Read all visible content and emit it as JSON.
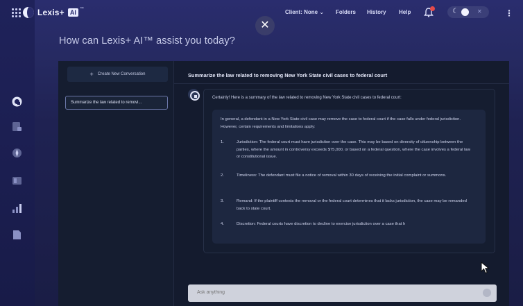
{
  "app": {
    "logo_text": "Lexis+",
    "logo_ai": "AI",
    "logo_tm": "™",
    "heading": "How can Lexis+ AI™ assist you today?"
  },
  "nav": {
    "client": "Client: None ⌄",
    "folders": "Folders",
    "history": "History",
    "help": "Help",
    "close_symbol": "✕",
    "moon_symbol": "☾",
    "toggle_off_symbol": "✕",
    "kebab_symbol": "⋮"
  },
  "sidebar": {
    "new_conversation": "Create New Conversation",
    "plus_symbol": "+",
    "conversations": [
      {
        "label": "Summarize the law related to removi..."
      }
    ]
  },
  "conversation": {
    "title": "Summarize the law related to removing New York State civil cases to federal court",
    "intro": "Certainly! Here is a summary of the law related to removing New York State civil cases to federal court:",
    "paragraph": "In general, a defendant in a New York State civil case may remove the case to federal court if the case falls under federal jurisdiction. However, certain requirements and limitations apply:",
    "items": [
      {
        "num": "1.",
        "text": "Jurisdiction: The federal court must have jurisdiction over the case. This may be based on diversity of citizenship between the parties, where the amount in controversy exceeds $75,000, or based on a federal question, where the case involves a federal law or constitutional issue."
      },
      {
        "num": "2.",
        "text": "Timeliness: The defendant must file a notice of removal within 30 days of receiving the initial complaint or summons."
      },
      {
        "num": "3.",
        "text": "Remand: If the plaintiff contests the removal or the federal court determines that it lacks jurisdiction, the case may be remanded back to state court."
      },
      {
        "num": "4.",
        "text": "Discretion: Federal courts have discretion to decline to exercise jurisdiction over a case that h"
      }
    ]
  },
  "input": {
    "placeholder": "Ask anything"
  },
  "icons": {
    "rail": [
      "grid-menu-icon",
      "lexis-ai-icon",
      "document-icon",
      "compass-icon",
      "folder-icon",
      "chart-icon",
      "file-icon"
    ],
    "top": [
      "close-icon",
      "bell-icon",
      "theme-toggle-icon",
      "more-options-icon"
    ]
  },
  "colors": {
    "notification": "#e54a4a",
    "accent": "#6c74c8"
  }
}
